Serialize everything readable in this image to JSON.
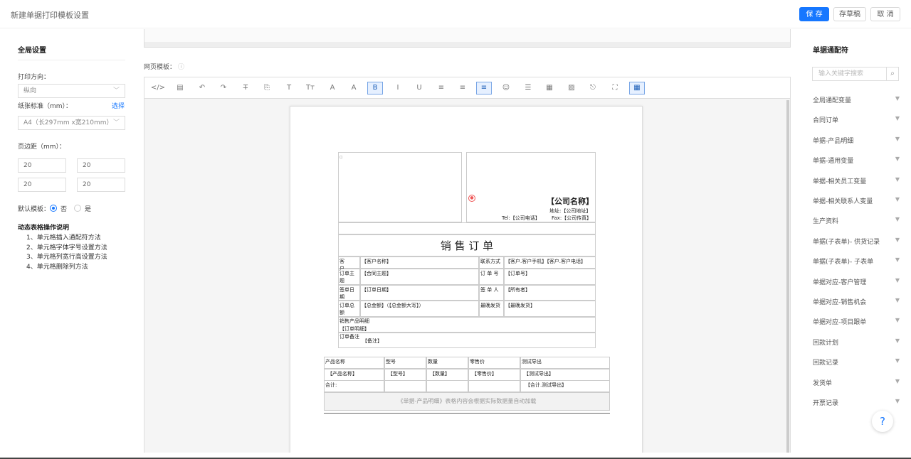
{
  "header": {
    "title": "新建单据打印模板设置",
    "save": "保 存",
    "draft": "存草稿",
    "cancel": "取 消"
  },
  "left": {
    "section_title": "全局设置",
    "orientation_label": "打印方向：",
    "orientation_value": "纵向",
    "paper_label": "纸张标准（mm）：",
    "paper_select_link": "选择",
    "paper_value": "A4（长297mm x宽210mm）",
    "margin_label": "页边距（mm）：",
    "margins": [
      "20",
      "20",
      "20",
      "20"
    ],
    "default_tpl_label": "默认模板：",
    "default_no": "否",
    "default_yes": "是",
    "default_selected": "否",
    "help_title": "动态表格操作说明",
    "help_steps": [
      "1、单元格插入通配符方法",
      "2、单元格字体字号设置方法",
      "3、单元格列宽行高设置方法",
      "4、单元格删除列方法"
    ]
  },
  "center": {
    "webtpl_label": "网页模板：",
    "toolbar_icons": [
      "code-icon",
      "template-icon",
      "undo-icon",
      "redo-icon",
      "strikethrough-icon",
      "format-icon",
      "text-icon",
      "font-size-icon",
      "font-color-icon",
      "background-color-icon",
      "bold-icon",
      "italic-icon",
      "underline-icon",
      "align-left-icon",
      "align-center-icon",
      "align-right-icon",
      "emoji-icon",
      "line-height-icon",
      "table-icon",
      "image-icon",
      "attachment-icon",
      "fullscreen-icon",
      "grid-icon"
    ],
    "toolbar_glyphs": [
      "</>",
      "▤",
      "↶",
      "↷",
      "T̶",
      "⎘",
      "T",
      "Tт",
      "A",
      "A",
      "B",
      "I",
      "U",
      "≡",
      "≡",
      "≡",
      "☺",
      "☰",
      "▦",
      "▨",
      "⎋",
      "⛶",
      "▦"
    ],
    "doc": {
      "company_name": "【公司名称】",
      "address": "地址:【公司地址】",
      "tel": "Tel:【公司电话】",
      "fax": "Fax:【公司传真】",
      "title": "销 售 订 单",
      "rows": [
        {
          "l": "客　　户",
          "lv": "【客户名称】",
          "r": "联系方式",
          "rv": "【客户.客户手机】【客户.客户电话】"
        },
        {
          "l": "订单主题",
          "lv": "【合同主题】",
          "r": "订 单 号",
          "rv": "【订单号】"
        },
        {
          "l": "签单日期",
          "lv": "【订单日期】",
          "r": "签 单 人",
          "rv": "【所有者】"
        },
        {
          "l": "订单总额",
          "lv": "【总金额】（【总金额大写】）",
          "r": "最晚发货",
          "rv": "【最晚发货】"
        }
      ],
      "product_detail_label": "销售产品明细",
      "product_detail_value": "【订单明细】",
      "remark_label": "订单备注",
      "remark_value": "【备注】",
      "product_table": {
        "headers": [
          "产品名称",
          "型号",
          "数量",
          "零售价",
          "测试导出"
        ],
        "row": [
          "【产品名称】",
          "【型号】",
          "【数量】",
          "【零售价】",
          "【测试导出】"
        ],
        "total_label": "合计:",
        "total_value": "【合计.测试导出】",
        "note": "《单据-产品明细》表格内容会根据实际数据量自动加载"
      }
    }
  },
  "right": {
    "title": "单据通配符",
    "search_placeholder": "输入关键字搜索",
    "vars": [
      "全局通配变量",
      "合同订单",
      "单据-产品明细",
      "单据-通用变量",
      "单据-相关员工变量",
      "单据-相关联系人变量",
      "生产资料",
      "单据(子表单)- 供货记录",
      "单据(子表单)- 子表单",
      "单据对应-客户管理",
      "单据对应-销售机会",
      "单据对应-项目跟单",
      "回款计划",
      "回款记录",
      "发货单",
      "开票记录"
    ]
  }
}
